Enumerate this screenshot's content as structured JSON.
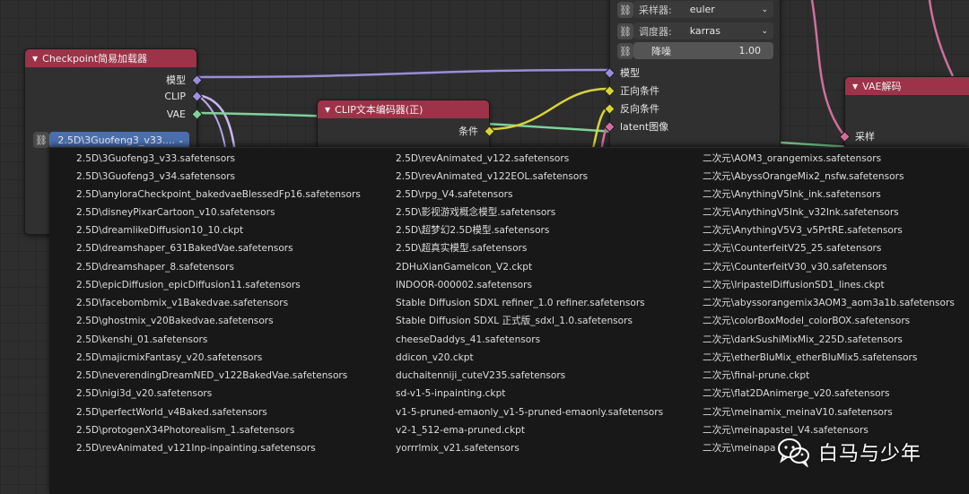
{
  "nodes": {
    "checkpoint": {
      "title": "Checkpoint简易加载器",
      "outputs": [
        "模型",
        "CLIP",
        "VAE"
      ],
      "ckpt_value": "2.5D\\3Guofeng3_v33...."
    },
    "clip_encode": {
      "title": "CLIP文本编码器(正)",
      "output": "条件"
    },
    "ksampler": {
      "sampler_label": "采样器:",
      "sampler_value": "euler",
      "scheduler_label": "调度器:",
      "scheduler_value": "karras",
      "denoise_label": "降噪",
      "denoise_value": "1.00",
      "inputs": [
        "模型",
        "正向条件",
        "反向条件",
        "latent图像"
      ]
    },
    "vae_decode": {
      "title": "VAE解码",
      "input": "采样"
    }
  },
  "dropdown": {
    "col1": [
      "2.5D\\3Guofeng3_v33.safetensors",
      "2.5D\\3Guofeng3_v34.safetensors",
      "2.5D\\anyloraCheckpoint_bakedvaeBlessedFp16.safetensors",
      "2.5D\\disneyPixarCartoon_v10.safetensors",
      "2.5D\\dreamlikeDiffusion10_10.ckpt",
      "2.5D\\dreamshaper_631BakedVae.safetensors",
      "2.5D\\dreamshaper_8.safetensors",
      "2.5D\\epicDiffusion_epicDiffusion11.safetensors",
      "2.5D\\facebombmix_v1Bakedvae.safetensors",
      "2.5D\\ghostmix_v20Bakedvae.safetensors",
      "2.5D\\kenshi_01.safetensors",
      "2.5D\\majicmixFantasy_v20.safetensors",
      "2.5D\\neverendingDreamNED_v122BakedVae.safetensors",
      "2.5D\\nigi3d_v20.safetensors",
      "2.5D\\perfectWorld_v4Baked.safetensors",
      "2.5D\\protogenX34Photorealism_1.safetensors",
      "2.5D\\revAnimated_v121Inp-inpainting.safetensors"
    ],
    "col2": [
      "2.5D\\revAnimated_v122.safetensors",
      "2.5D\\revAnimated_v122EOL.safetensors",
      "2.5D\\rpg_V4.safetensors",
      "2.5D\\影视游戏概念模型.safetensors",
      "2.5D\\超梦幻2.5D模型.safetensors",
      "2.5D\\超真实模型.safetensors",
      "2DHuXianGameIcon_V2.ckpt",
      "INDOOR-000002.safetensors",
      "Stable Diffusion SDXL refiner_1.0 refiner.safetensors",
      "Stable Diffusion SDXL 正式版_sdxl_1.0.safetensors",
      "cheeseDaddys_41.safetensors",
      "ddicon_v20.ckpt",
      "duchaitenniji_cuteV235.safetensors",
      "sd-v1-5-inpainting.ckpt",
      "v1-5-pruned-emaonly_v1-5-pruned-emaonly.safetensors",
      "v2-1_512-ema-pruned.ckpt",
      "yorrrlmix_v21.safetensors"
    ],
    "col3": [
      "二次元\\AOM3_orangemixs.safetensors",
      "二次元\\AbyssOrangeMix2_nsfw.safetensors",
      "二次元\\AnythingV5Ink_ink.safetensors",
      "二次元\\AnythingV5Ink_v32Ink.safetensors",
      "二次元\\AnythingV5V3_v5PrtRE.safetensors",
      "二次元\\CounterfeitV25_25.safetensors",
      "二次元\\CounterfeitV30_v30.safetensors",
      "二次元\\IripastelDiffusionSD1_lines.ckpt",
      "二次元\\abyssorangemix3AOM3_aom3a1b.safetensors",
      "二次元\\colorBoxModel_colorBOX.safetensors",
      "二次元\\darkSushiMixMix_225D.safetensors",
      "二次元\\etherBluMix_etherBluMix5.safetensors",
      "二次元\\final-prune.ckpt",
      "二次元\\flat2DAnimerge_v20.safetensors",
      "二次元\\meinamix_meinaV10.safetensors",
      "二次元\\meinapastel_V4.safetensors",
      "二次元\\meinapa"
    ]
  },
  "watermark": {
    "text": "白马与少年",
    "icon": "wechat-icon"
  }
}
